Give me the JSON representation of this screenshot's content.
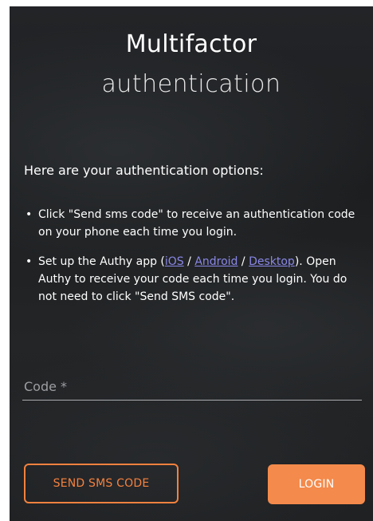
{
  "title": {
    "line1": "Multifactor",
    "line2": "authentication"
  },
  "intro": "Here are your authentication options:",
  "options": [
    {
      "text": "Click \"Send sms code\" to receive an authentication code on your phone each time you login."
    },
    {
      "text_before": "Set up the Authy app (",
      "links": [
        "iOS",
        "Android",
        "Desktop"
      ],
      "separator": " / ",
      "text_after": "). Open Authy to receive your code each time you login. You do not need to click \"Send SMS code\"."
    }
  ],
  "code_field": {
    "placeholder": "Code *",
    "value": ""
  },
  "buttons": {
    "send_sms": "SEND SMS CODE",
    "login": "LOGIN"
  },
  "colors": {
    "accent": "#f48a4b",
    "link": "#8a87e6",
    "panel_bg": "#202224"
  }
}
